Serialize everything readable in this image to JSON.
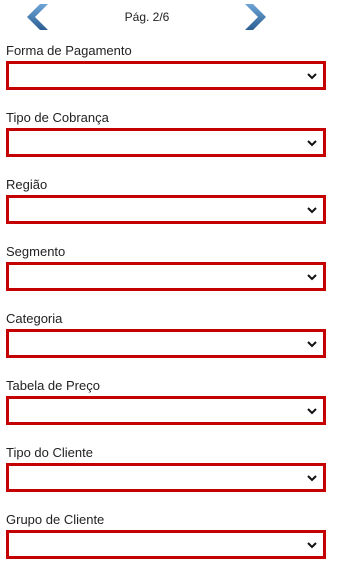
{
  "pager": {
    "label": "Pág. 2/6",
    "prev_icon": "chevron-left-icon",
    "next_icon": "chevron-right-icon",
    "arrow_color": "#3d78b3"
  },
  "form": {
    "border_color": "#c40000",
    "fields": [
      {
        "label": "Forma de Pagamento",
        "value": ""
      },
      {
        "label": "Tipo de Cobrança",
        "value": ""
      },
      {
        "label": "Região",
        "value": ""
      },
      {
        "label": "Segmento",
        "value": ""
      },
      {
        "label": "Categoria",
        "value": ""
      },
      {
        "label": "Tabela de Preço",
        "value": ""
      },
      {
        "label": "Tipo do Cliente",
        "value": ""
      },
      {
        "label": "Grupo de Cliente",
        "value": ""
      }
    ]
  }
}
